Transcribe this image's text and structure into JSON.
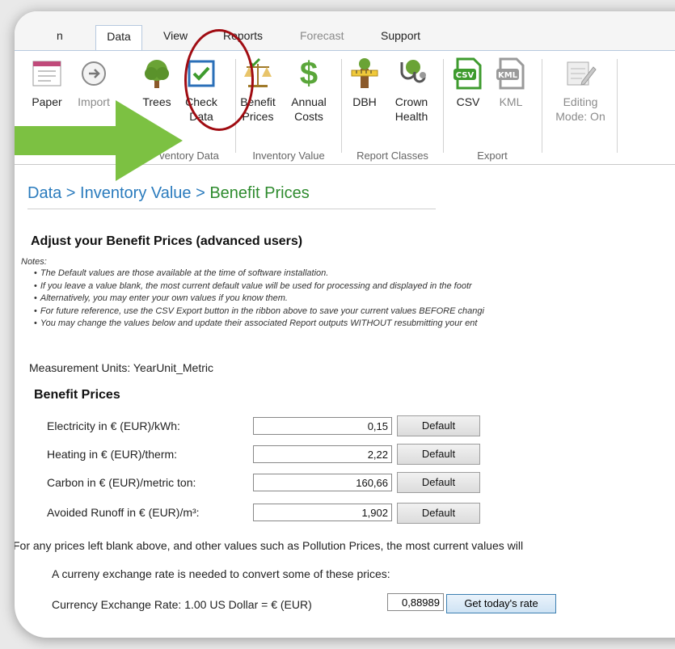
{
  "tabs": [
    {
      "label": "Data",
      "state": "active"
    },
    {
      "label": "View",
      "state": "normal"
    },
    {
      "label": "Reports",
      "state": "normal"
    },
    {
      "label": "Forecast",
      "state": "disabled"
    },
    {
      "label": "Support",
      "state": "normal"
    }
  ],
  "tab_partial": "n",
  "ribbon": {
    "buttons": {
      "paper": "Paper",
      "import": "Import",
      "trees": "Trees",
      "check_data_1": "Check",
      "check_data_2": "Data",
      "benefit_prices_1": "Benefit",
      "benefit_prices_2": "Prices",
      "annual_costs_1": "Annual",
      "annual_costs_2": "Costs",
      "dbh": "DBH",
      "crown_health_1": "Crown",
      "crown_health_2": "Health",
      "csv": "CSV",
      "kml": "KML",
      "editing_mode_1": "Editing",
      "editing_mode_2": "Mode: On"
    },
    "groups": {
      "inventory_data": "ventory Data",
      "inventory_value": "Inventory Value",
      "report_classes": "Report Classes",
      "export": "Export"
    },
    "icons": {
      "paper": "paper-form-icon",
      "import": "arrow-right-circle-icon",
      "trees": "tree-icon",
      "check_data": "checkbox-checked-icon",
      "benefit_prices": "balance-scale-icon",
      "annual_costs": "dollar-icon",
      "dbh": "tree-measure-icon",
      "crown_health": "stethoscope-icon",
      "csv": "csv-file-icon",
      "kml": "kml-file-icon",
      "editing_mode": "edit-pencil-icon"
    }
  },
  "breadcrumb": {
    "part1": "Data",
    "sep1": " > ",
    "part2": "Inventory Value",
    "sep2": " > ",
    "current": "Benefit Prices"
  },
  "main": {
    "title": "Adjust your Benefit Prices (advanced users)",
    "notes_label": "Notes:",
    "notes": [
      "The Default values are those available at the time of software installation.",
      "If you leave a value blank, the most current default value will be used for processing and displayed in the footr",
      "Alternatively, you may enter your own values if you know them.",
      "For future reference, use the CSV Export button in the ribbon above to save your current values BEFORE changi",
      "You may change the values below and update their associated Report outputs WITHOUT resubmitting your ent"
    ],
    "measurement_units": "Measurement Units: YearUnit_Metric",
    "benefit_heading": "Benefit Prices",
    "prices": [
      {
        "label": "Electricity in € (EUR)/kWh:",
        "value": "0,15",
        "button": "Default"
      },
      {
        "label": "Heating in € (EUR)/therm:",
        "value": "2,22",
        "button": "Default"
      },
      {
        "label": "Carbon in € (EUR)/metric ton:",
        "value": "160,66",
        "button": "Default"
      },
      {
        "label": "Avoided Runoff in € (EUR)/m³:",
        "value": "1,902",
        "button": "Default"
      }
    ],
    "footnote": "For any prices left blank above, and other values such as Pollution Prices, the most current values will",
    "exchange_note": "A curreny exchange rate is needed to convert some of these prices:",
    "exchange_label": "Currency Exchange Rate: 1.00 US Dollar = € (EUR)",
    "exchange_value": "0,88989",
    "exchange_button": "Get today's rate"
  },
  "colors": {
    "breadcrumb_link": "#2a7bbd",
    "breadcrumb_current": "#2e8b2e",
    "highlight_circle": "#a00c12",
    "arrow": "#7cc142"
  }
}
